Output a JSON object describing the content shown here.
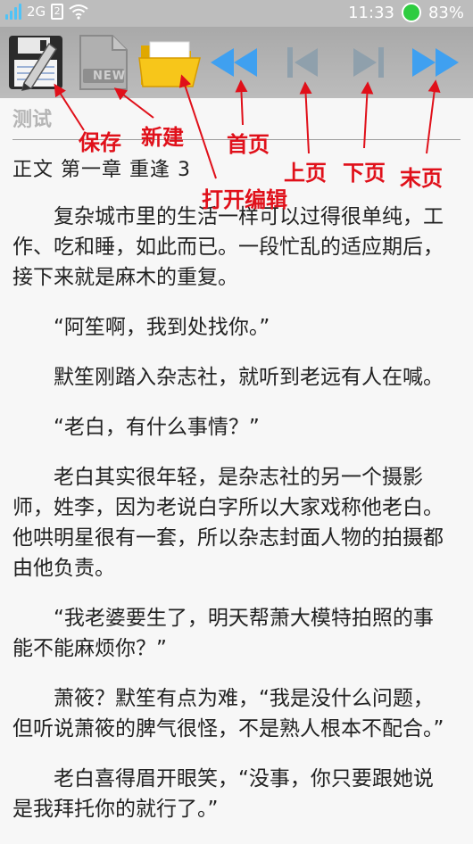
{
  "status": {
    "network": "2G",
    "sim": "2",
    "time": "11:33",
    "battery": "83%"
  },
  "toolbar": {
    "save_icon": "floppy-disk-pencil-icon",
    "new_icon": "new-document-icon",
    "new_label": "NEW",
    "open_icon": "folder-open-icon",
    "first_icon": "double-chevron-left-icon",
    "prev_icon": "skip-previous-icon",
    "next_icon": "skip-next-icon",
    "last_icon": "double-chevron-right-icon"
  },
  "annotations": {
    "save": "保存",
    "new": "新建",
    "first": "首页",
    "open_edit": "打开编辑",
    "prev": "上页",
    "next": "下页",
    "last": "末页"
  },
  "document": {
    "title": "测试",
    "chapter": "正文 第一章  重逢 3",
    "paragraphs": [
      "复杂城市里的生活一样可以过得很单纯，工作、吃和睡，如此而已。一段忙乱的适应期后，接下来就是麻木的重复。",
      "“阿笙啊，我到处找你。”",
      "默笙刚踏入杂志社，就听到老远有人在喊。",
      "“老白，有什么事情？”",
      "老白其实很年轻，是杂志社的另一个摄影师，姓李，因为老说白字所以大家戏称他老白。他哄明星很有一套，所以杂志封面人物的拍摄都由他负责。",
      "“我老婆要生了，明天帮萧大模特拍照的事能不能麻烦你？”",
      "萧筱？默笙有点为难，“我是没什么问题，但听说萧筱的脾气很怪，不是熟人根本不配合。”",
      "老白喜得眉开眼笑，“没事，你只要跟她说是我拜托你的就行了。”"
    ]
  },
  "colors": {
    "annotation": "#e0101a",
    "toolbar_arrow": "#3fa0f0",
    "toolbar_arrow_disabled": "#8fa0ac",
    "battery": "#2ecc40"
  }
}
